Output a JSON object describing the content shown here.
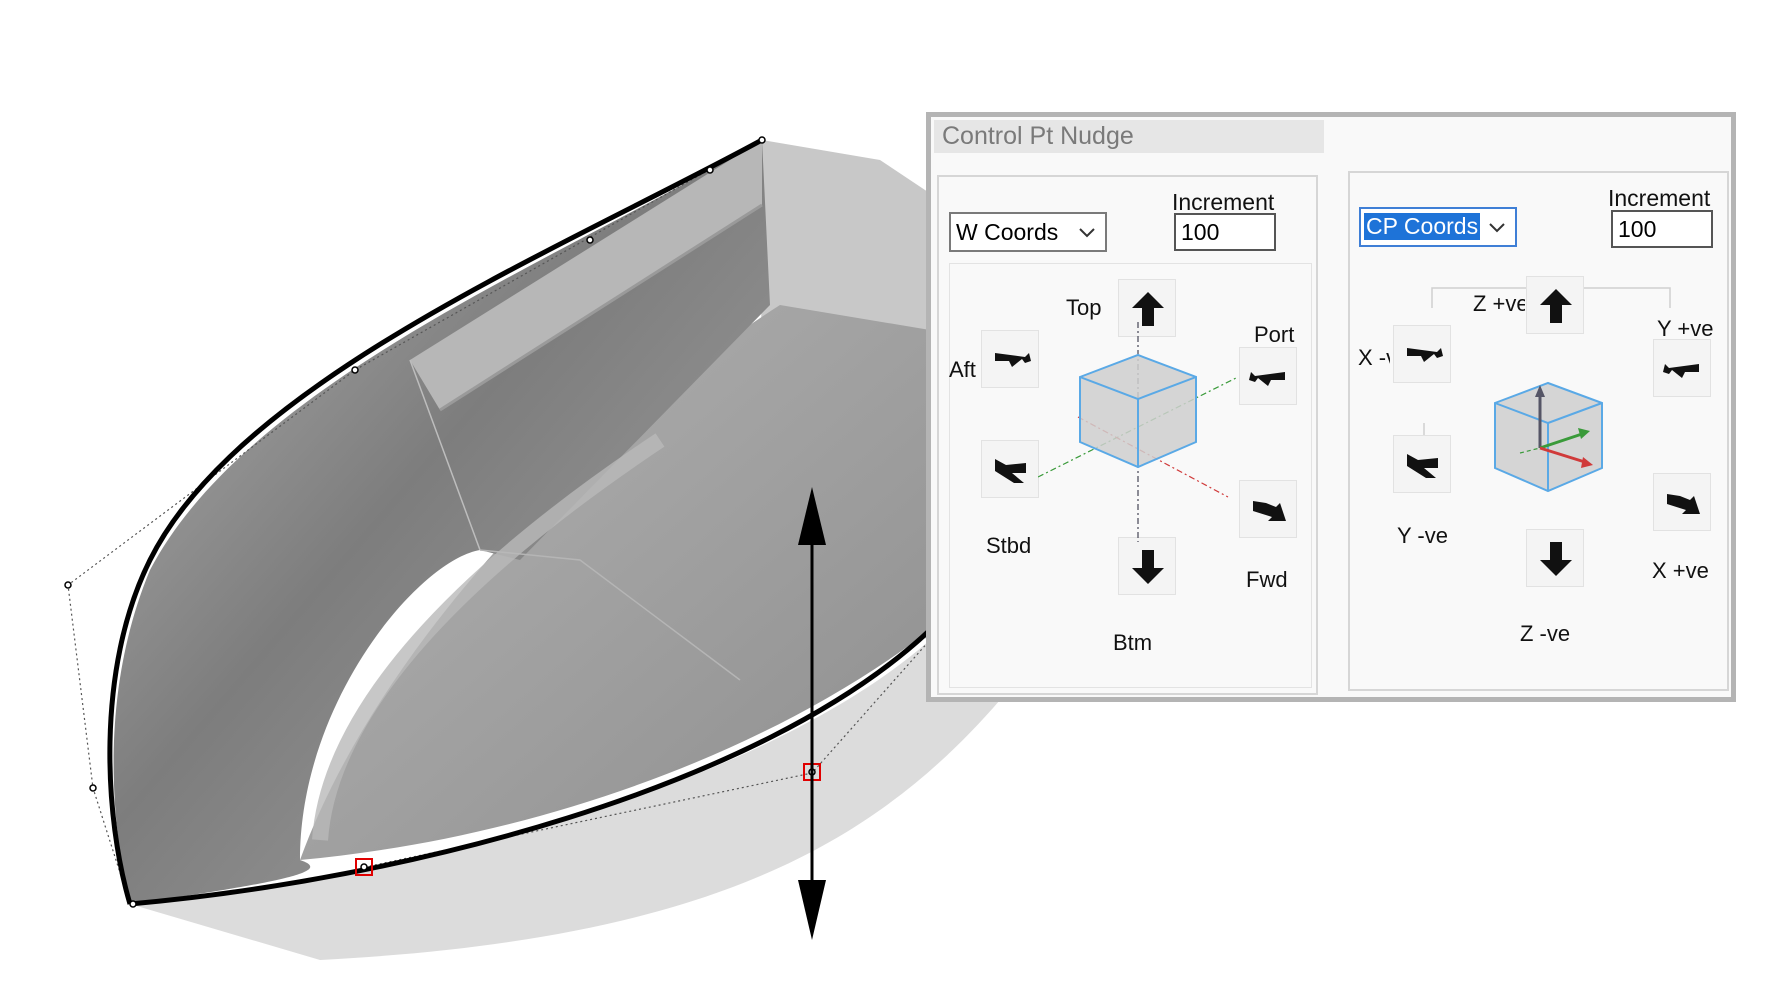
{
  "panel": {
    "title": "Control Pt Nudge",
    "world": {
      "coord_system": "W Coords",
      "increment_label": "Increment",
      "increment_value": "100",
      "labels": {
        "top": "Top",
        "port": "Port",
        "aft": "Aft",
        "stbd": "Stbd",
        "fwd": "Fwd",
        "btm": "Btm"
      }
    },
    "control_point": {
      "coord_system": "CP Coords",
      "increment_label": "Increment",
      "increment_value": "100",
      "labels": {
        "z_pos": "Z +ve",
        "y_pos": "Y +ve",
        "x_neg": "X -ve",
        "y_neg": "Y -ve",
        "x_pos": "X +ve",
        "z_neg": "Z -ve"
      }
    }
  },
  "colors": {
    "hull_dark": "#8c8c8c",
    "hull_light": "#d4d4d4",
    "selected_point": "#e00000",
    "combo_highlight": "#1e73d8",
    "cube_edge": "#5aa9e6"
  },
  "icons": [
    "up-arrow-icon",
    "down-arrow-icon",
    "nudge-aft-icon",
    "nudge-port-icon",
    "nudge-stbd-icon",
    "nudge-fwd-icon",
    "chevron-down-icon",
    "cube-icon"
  ]
}
